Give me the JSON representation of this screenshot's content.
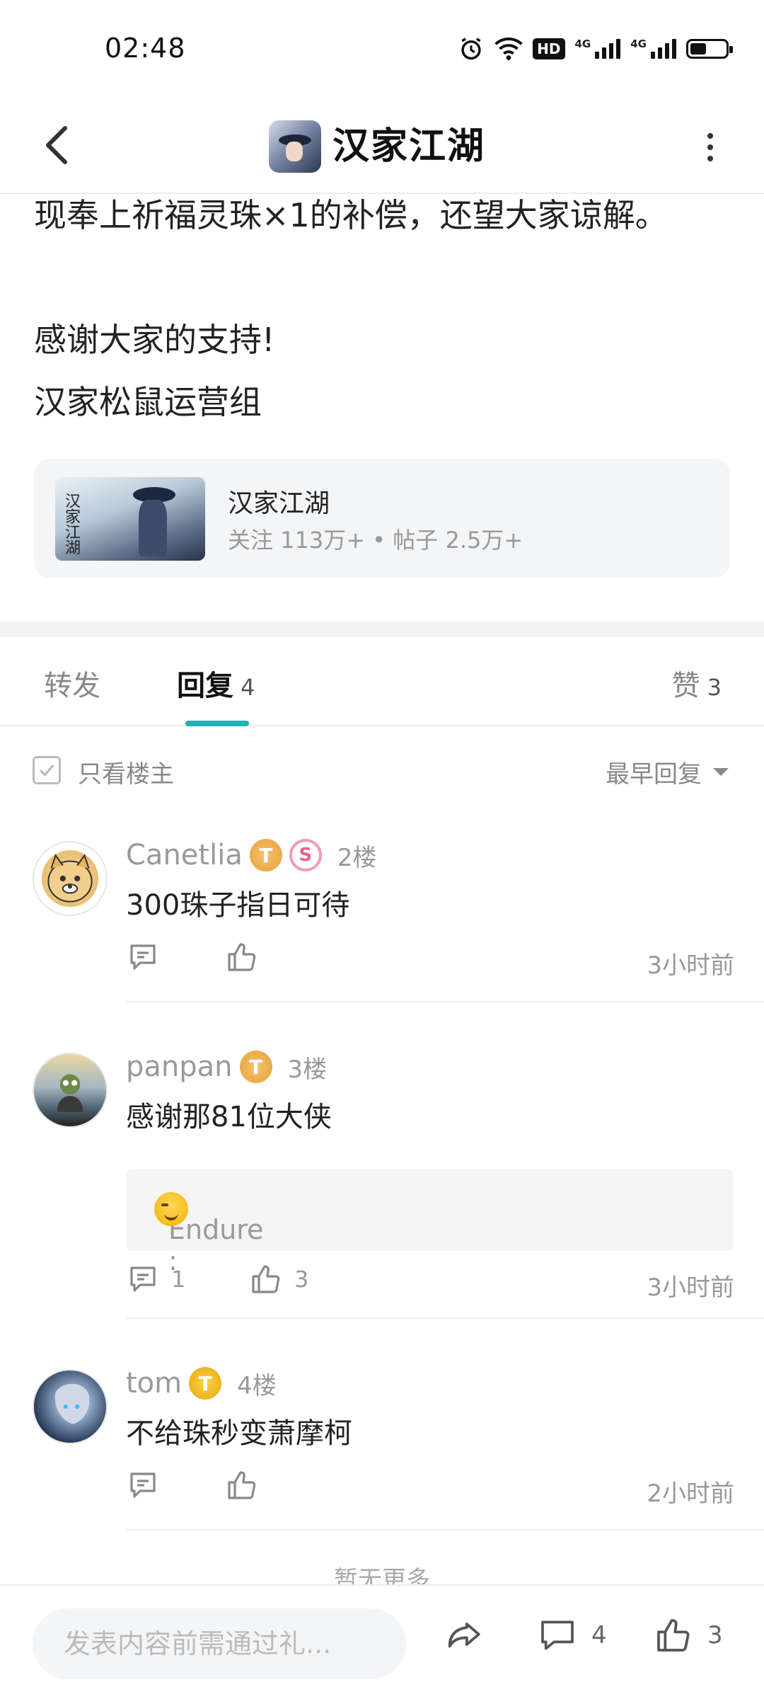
{
  "status_bar": {
    "time": "02:48",
    "hd": "HD",
    "net1": "4G",
    "net2": "4G"
  },
  "header": {
    "title": "汉家江湖"
  },
  "post": {
    "lines": [
      "现奉上祈福灵珠×1的补偿，还望大家谅解。",
      "感谢大家的支持!",
      "汉家松鼠运营组"
    ]
  },
  "forum_card": {
    "name": "汉家江湖",
    "thumb_calligraphy": "汉家江湖",
    "meta": "关注 113万+ • 帖子 2.5万+"
  },
  "tabs": {
    "forward": "转发",
    "replies": "回复",
    "replies_count": "4",
    "likes": "赞",
    "likes_count": "3"
  },
  "filter": {
    "only_op": "只看楼主",
    "sort": "最早回复"
  },
  "replies": [
    {
      "user": "Canetlia",
      "badge": "T",
      "badge2": "S",
      "floor": "2楼",
      "text": "300珠子指日可待",
      "comments": "",
      "likes": "",
      "time": "3小时前"
    },
    {
      "user": "panpan",
      "badge": "T",
      "floor": "3楼",
      "text": "感谢那81位大侠",
      "quote": "Endure :",
      "comments": "1",
      "likes": "3",
      "time": "3小时前"
    },
    {
      "user": "tom",
      "badge": "T",
      "floor": "4楼",
      "text": "不给珠秒变萧摩柯",
      "comments": "",
      "likes": "",
      "time": "2小时前"
    }
  ],
  "no_more": "暂无更多",
  "bottom_bar": {
    "placeholder": "发表内容前需通过礼...",
    "comment_count": "4",
    "like_count": "3"
  }
}
